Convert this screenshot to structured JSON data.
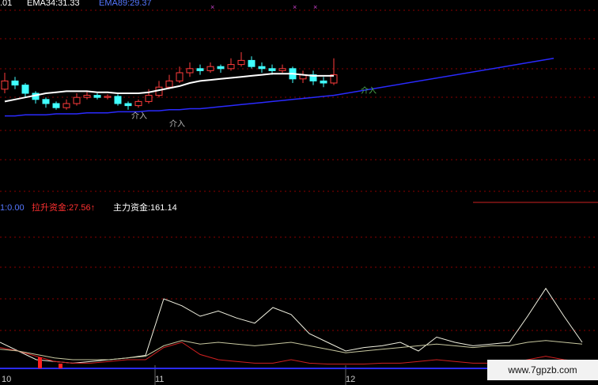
{
  "header": {
    "fragment": ".01",
    "ema34": "EMA34:31.33",
    "ema89": "EMA89:29.37"
  },
  "panel2_header": {
    "value0": "1:0.00",
    "lift_label": "拉升资金:27.56↑",
    "main_label": "主力资金:161.14"
  },
  "annotations": [
    "介入",
    "介入",
    "介入"
  ],
  "x_ticks": [
    "10",
    "11",
    "12"
  ],
  "watermark": "www.7gpzb.com",
  "colors": {
    "up": "#ff3b3b",
    "down": "#40ffff",
    "ema_white": "#ffffff",
    "ema_blue": "#2a2aff",
    "grid": "#8b0000",
    "ema34_text": "#ffffff",
    "ema89_text": "#5577ff",
    "lift_text": "#ff3030",
    "main_text": "#ffffff"
  },
  "chart_data": [
    {
      "type": "line",
      "panel": "candlestick",
      "title": "",
      "ylim": [
        0,
        100
      ],
      "series": [
        {
          "name": "EMA34",
          "values": [
            32,
            34,
            36,
            38,
            40,
            41,
            42,
            42,
            42,
            41,
            41,
            40,
            40,
            40,
            41,
            43,
            45,
            47,
            50,
            52,
            53,
            54,
            55,
            56,
            57,
            58,
            59,
            59,
            59,
            58,
            57,
            57,
            57
          ]
        },
        {
          "name": "EMA89",
          "values": [
            18,
            18,
            19,
            19,
            19,
            20,
            20,
            20,
            21,
            21,
            21,
            22,
            22,
            22,
            23,
            23,
            24,
            24,
            25,
            25,
            26,
            27,
            28,
            29,
            30,
            31,
            32,
            33,
            34,
            35,
            36,
            37,
            38
          ]
        }
      ],
      "candles": [
        {
          "o": 44,
          "c": 52,
          "h": 60,
          "l": 40
        },
        {
          "o": 52,
          "c": 48,
          "h": 56,
          "l": 44
        },
        {
          "o": 48,
          "c": 40,
          "h": 50,
          "l": 36
        },
        {
          "o": 40,
          "c": 34,
          "h": 42,
          "l": 30
        },
        {
          "o": 34,
          "c": 30,
          "h": 36,
          "l": 26
        },
        {
          "o": 30,
          "c": 26,
          "h": 32,
          "l": 24
        },
        {
          "o": 26,
          "c": 30,
          "h": 34,
          "l": 24
        },
        {
          "o": 30,
          "c": 36,
          "h": 40,
          "l": 28
        },
        {
          "o": 36,
          "c": 38,
          "h": 42,
          "l": 34
        },
        {
          "o": 38,
          "c": 36,
          "h": 40,
          "l": 34
        },
        {
          "o": 36,
          "c": 37,
          "h": 39,
          "l": 34
        },
        {
          "o": 37,
          "c": 30,
          "h": 39,
          "l": 28
        },
        {
          "o": 30,
          "c": 28,
          "h": 32,
          "l": 24
        },
        {
          "o": 28,
          "c": 32,
          "h": 34,
          "l": 26
        },
        {
          "o": 32,
          "c": 38,
          "h": 44,
          "l": 30
        },
        {
          "o": 38,
          "c": 46,
          "h": 52,
          "l": 36
        },
        {
          "o": 46,
          "c": 52,
          "h": 58,
          "l": 44
        },
        {
          "o": 52,
          "c": 60,
          "h": 66,
          "l": 50
        },
        {
          "o": 60,
          "c": 64,
          "h": 70,
          "l": 56
        },
        {
          "o": 64,
          "c": 62,
          "h": 68,
          "l": 58
        },
        {
          "o": 62,
          "c": 66,
          "h": 70,
          "l": 60
        },
        {
          "o": 66,
          "c": 64,
          "h": 68,
          "l": 60
        },
        {
          "o": 64,
          "c": 68,
          "h": 74,
          "l": 62
        },
        {
          "o": 68,
          "c": 72,
          "h": 80,
          "l": 66
        },
        {
          "o": 72,
          "c": 66,
          "h": 76,
          "l": 64
        },
        {
          "o": 66,
          "c": 64,
          "h": 70,
          "l": 60
        },
        {
          "o": 64,
          "c": 62,
          "h": 68,
          "l": 58
        },
        {
          "o": 62,
          "c": 64,
          "h": 68,
          "l": 60
        },
        {
          "o": 64,
          "c": 54,
          "h": 66,
          "l": 50
        },
        {
          "o": 54,
          "c": 58,
          "h": 62,
          "l": 50
        },
        {
          "o": 58,
          "c": 52,
          "h": 62,
          "l": 48
        },
        {
          "o": 52,
          "c": 50,
          "h": 56,
          "l": 46
        },
        {
          "o": 50,
          "c": 58,
          "h": 74,
          "l": 48
        }
      ]
    },
    {
      "type": "line",
      "panel": "indicator",
      "title": "",
      "ylim": [
        0,
        100
      ],
      "series": [
        {
          "name": "主力资金",
          "values": [
            30,
            20,
            10,
            8,
            6,
            8,
            10,
            12,
            15,
            80,
            72,
            60,
            66,
            58,
            52,
            70,
            62,
            40,
            30,
            20,
            24,
            26,
            30,
            20,
            36,
            30,
            26,
            28,
            30,
            60,
            92,
            60,
            30
          ]
        },
        {
          "name": "拉升资金",
          "values": [
            24,
            20,
            14,
            8,
            6,
            6,
            8,
            10,
            10,
            24,
            30,
            16,
            10,
            8,
            6,
            6,
            10,
            6,
            5,
            5,
            5,
            6,
            6,
            8,
            10,
            8,
            6,
            6,
            6,
            10,
            14,
            10,
            8
          ]
        },
        {
          "name": "",
          "values": [
            22,
            20,
            16,
            12,
            10,
            10,
            10,
            12,
            14,
            26,
            32,
            28,
            30,
            28,
            26,
            28,
            30,
            26,
            22,
            18,
            20,
            22,
            24,
            26,
            28,
            26,
            24,
            26,
            26,
            30,
            32,
            30,
            28
          ]
        }
      ]
    }
  ]
}
